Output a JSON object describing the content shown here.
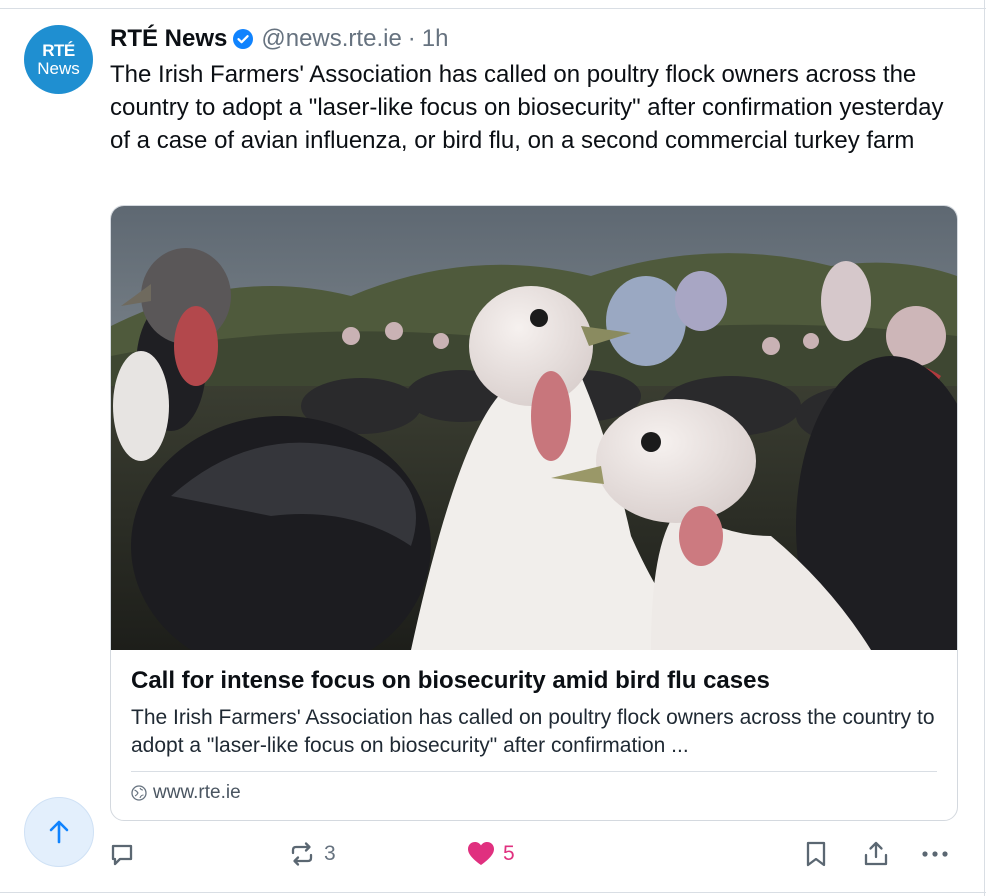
{
  "post": {
    "avatar": {
      "line1": "RTÉ",
      "line2": "News"
    },
    "author": {
      "display_name": "RTÉ News",
      "handle": "@news.rte.ie",
      "separator": "·",
      "time": "1h",
      "verified": true
    },
    "text": "The Irish Farmers' Association has called on poultry flock owners across the country to adopt a \"laser-like focus on biosecurity\" after confirmation yesterday of a case of avian influenza, or bird flu, on a second commercial turkey farm"
  },
  "link_card": {
    "image_icon": "turkey-flock-photo",
    "title": "Call for intense focus on biosecurity amid bird flu cases",
    "description": "The Irish Farmers' Association has called on poultry flock owners across the country to adopt a \"laser-like focus on biosecurity\" after confirmation ...",
    "domain": "www.rte.ie",
    "domain_icon": "globe-icon"
  },
  "actions": {
    "reply": {
      "icon": "reply-icon"
    },
    "repost": {
      "icon": "repost-icon",
      "count": "3"
    },
    "like": {
      "icon": "heart-icon",
      "count": "5",
      "liked": true
    },
    "bookmark": {
      "icon": "bookmark-icon"
    },
    "share": {
      "icon": "share-icon"
    },
    "more": {
      "icon": "more-options-icon"
    }
  },
  "scroll_to_top": {
    "icon": "arrow-up-icon"
  },
  "colors": {
    "accent": "#1083fe",
    "avatar_bg": "#1f8fd1",
    "like": "#e0307f",
    "muted_text": "#66727f",
    "border": "#d9dee4",
    "scroll_button_bg": "#e3effc"
  }
}
